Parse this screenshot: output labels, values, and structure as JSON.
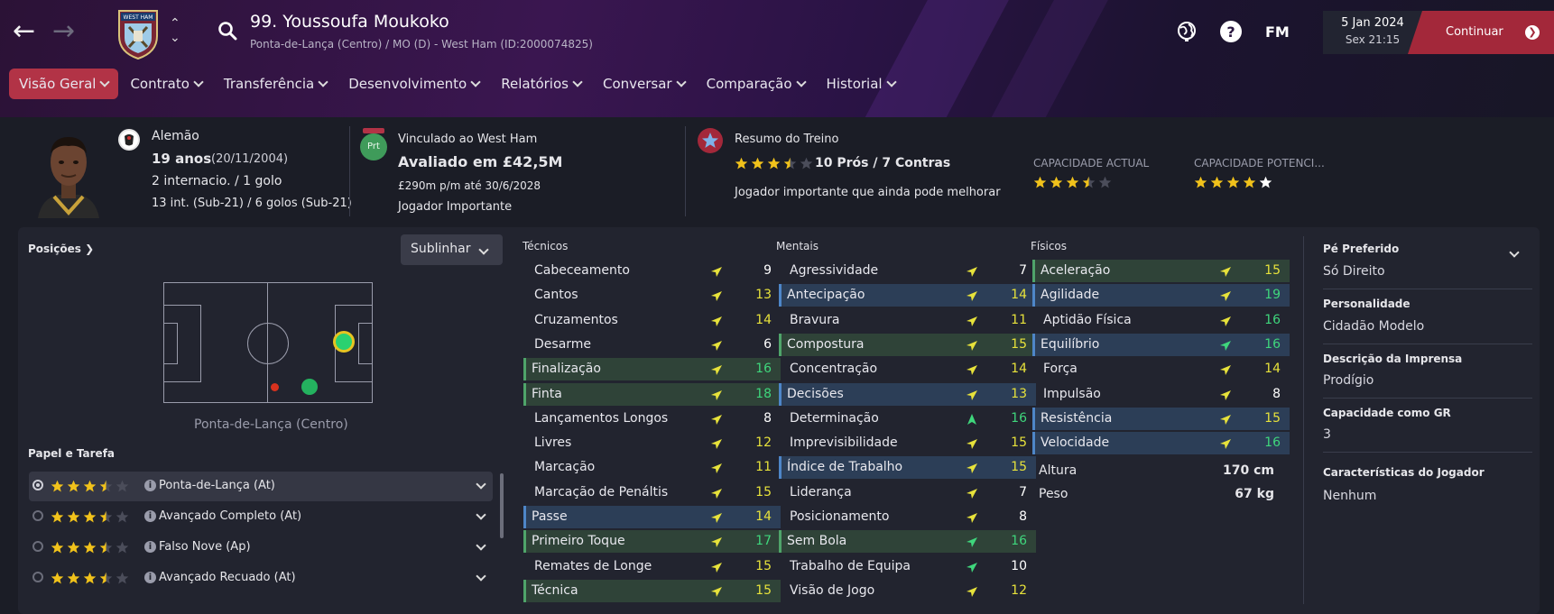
{
  "header": {
    "player_name": "99. Youssoufa Moukoko",
    "subtitle": "Ponta-de-Lança (Centro) / MO (D) - West Ham (ID:2000074825)",
    "club_logo_text": "WEST HAM",
    "fm_label": "FM",
    "date": "5 Jan 2024",
    "time": "Sex 21:15",
    "continue_label": "Continuar"
  },
  "tabs": [
    {
      "label": "Visão Geral",
      "active": true
    },
    {
      "label": "Contrato"
    },
    {
      "label": "Transferência"
    },
    {
      "label": "Desenvolvimento"
    },
    {
      "label": "Relatórios"
    },
    {
      "label": "Conversar"
    },
    {
      "label": "Comparação"
    },
    {
      "label": "Historial"
    }
  ],
  "info": {
    "nationality": "Alemão",
    "age": "19 anos",
    "dob": "(20/11/2004)",
    "caps": "2 internacio. / 1 golo",
    "u21": "13 int. (Sub-21) / 6 golos (Sub-21)",
    "contract_club": "Vinculado ao West Ham",
    "contract_badge": "Prt",
    "value": "Avaliado em £42,5M",
    "wage": "£290m p/m até 30/6/2028",
    "status": "Jogador Importante",
    "training_title": "Resumo do Treino",
    "training_stars": 3.5,
    "pros_cons": "10 Prós / 7 Contras",
    "training_note": "Jogador importante que ainda pode melhorar",
    "ca_label": "CAPACIDADE ACTUAL",
    "ca_stars": 3.5,
    "pa_label": "CAPACIDADE POTENCI...",
    "pa_stars": 5
  },
  "positions": {
    "title": "Posições",
    "highlight_label": "Sublinhar",
    "position_name": "Ponta-de-Lança (Centro)",
    "roles_title": "Papel e Tarefa",
    "roles": [
      {
        "label": "Ponta-de-Lança (At)",
        "stars": 3.5,
        "selected": true
      },
      {
        "label": "Avançado Completo (At)",
        "stars": 3.5
      },
      {
        "label": "Falso Nove (Ap)",
        "stars": 3.5
      },
      {
        "label": "Avançado Recuado (At)",
        "stars": 3.5
      }
    ]
  },
  "attributes": {
    "technical_title": "Técnicos",
    "mental_title": "Mentais",
    "physical_title": "Físicos",
    "technical": [
      {
        "name": "Cabeceamento",
        "value": "9",
        "hl": ""
      },
      {
        "name": "Cantos",
        "value": "13",
        "hl": ""
      },
      {
        "name": "Cruzamentos",
        "value": "14",
        "hl": ""
      },
      {
        "name": "Desarme",
        "value": "6",
        "hl": ""
      },
      {
        "name": "Finalização",
        "value": "16",
        "hl": "g"
      },
      {
        "name": "Finta",
        "value": "18",
        "hl": "g"
      },
      {
        "name": "Lançamentos Longos",
        "value": "8",
        "hl": ""
      },
      {
        "name": "Livres",
        "value": "12",
        "hl": ""
      },
      {
        "name": "Marcação",
        "value": "11",
        "hl": ""
      },
      {
        "name": "Marcação de Penáltis",
        "value": "15",
        "hl": ""
      },
      {
        "name": "Passe",
        "value": "14",
        "hl": "b"
      },
      {
        "name": "Primeiro Toque",
        "value": "17",
        "hl": "g"
      },
      {
        "name": "Remates de Longe",
        "value": "15",
        "hl": ""
      },
      {
        "name": "Técnica",
        "value": "15",
        "hl": "g"
      }
    ],
    "mental": [
      {
        "name": "Agressividade",
        "value": "7",
        "hl": ""
      },
      {
        "name": "Antecipação",
        "value": "14",
        "hl": "b"
      },
      {
        "name": "Bravura",
        "value": "11",
        "hl": ""
      },
      {
        "name": "Compostura",
        "value": "15",
        "hl": "g"
      },
      {
        "name": "Concentração",
        "value": "14",
        "hl": ""
      },
      {
        "name": "Decisões",
        "value": "13",
        "hl": "b"
      },
      {
        "name": "Determinação",
        "value": "16",
        "hl": "",
        "arrow": "up"
      },
      {
        "name": "Imprevisibilidade",
        "value": "15",
        "hl": ""
      },
      {
        "name": "Índice de Trabalho",
        "value": "15",
        "hl": "b"
      },
      {
        "name": "Liderança",
        "value": "7",
        "hl": ""
      },
      {
        "name": "Posicionamento",
        "value": "8",
        "hl": ""
      },
      {
        "name": "Sem Bola",
        "value": "16",
        "hl": "g",
        "arrow": "green"
      },
      {
        "name": "Trabalho de Equipa",
        "value": "10",
        "hl": "",
        "arrow": "green"
      },
      {
        "name": "Visão de Jogo",
        "value": "12",
        "hl": ""
      }
    ],
    "physical": [
      {
        "name": "Aceleração",
        "value": "15",
        "hl": "g"
      },
      {
        "name": "Agilidade",
        "value": "19",
        "hl": "b"
      },
      {
        "name": "Aptidão Física",
        "value": "16",
        "hl": ""
      },
      {
        "name": "Equilíbrio",
        "value": "16",
        "hl": "b",
        "arrow": "green"
      },
      {
        "name": "Força",
        "value": "14",
        "hl": ""
      },
      {
        "name": "Impulsão",
        "value": "8",
        "hl": ""
      },
      {
        "name": "Resistência",
        "value": "15",
        "hl": "b"
      },
      {
        "name": "Velocidade",
        "value": "16",
        "hl": "b"
      }
    ],
    "height_label": "Altura",
    "height": "170 cm",
    "weight_label": "Peso",
    "weight": "67 kg"
  },
  "profile": [
    {
      "label": "Pé Preferido",
      "value": "Só Direito"
    },
    {
      "label": "Personalidade",
      "value": "Cidadão Modelo"
    },
    {
      "label": "Descrição da Imprensa",
      "value": "Prodígio"
    },
    {
      "label": "Capacidade como GR",
      "value": "3"
    },
    {
      "label": "Características do Jogador",
      "value": "Nenhum"
    }
  ],
  "colors": {
    "accent": "#b23346",
    "good": "#3fd67c",
    "mid": "#e7e23b"
  }
}
